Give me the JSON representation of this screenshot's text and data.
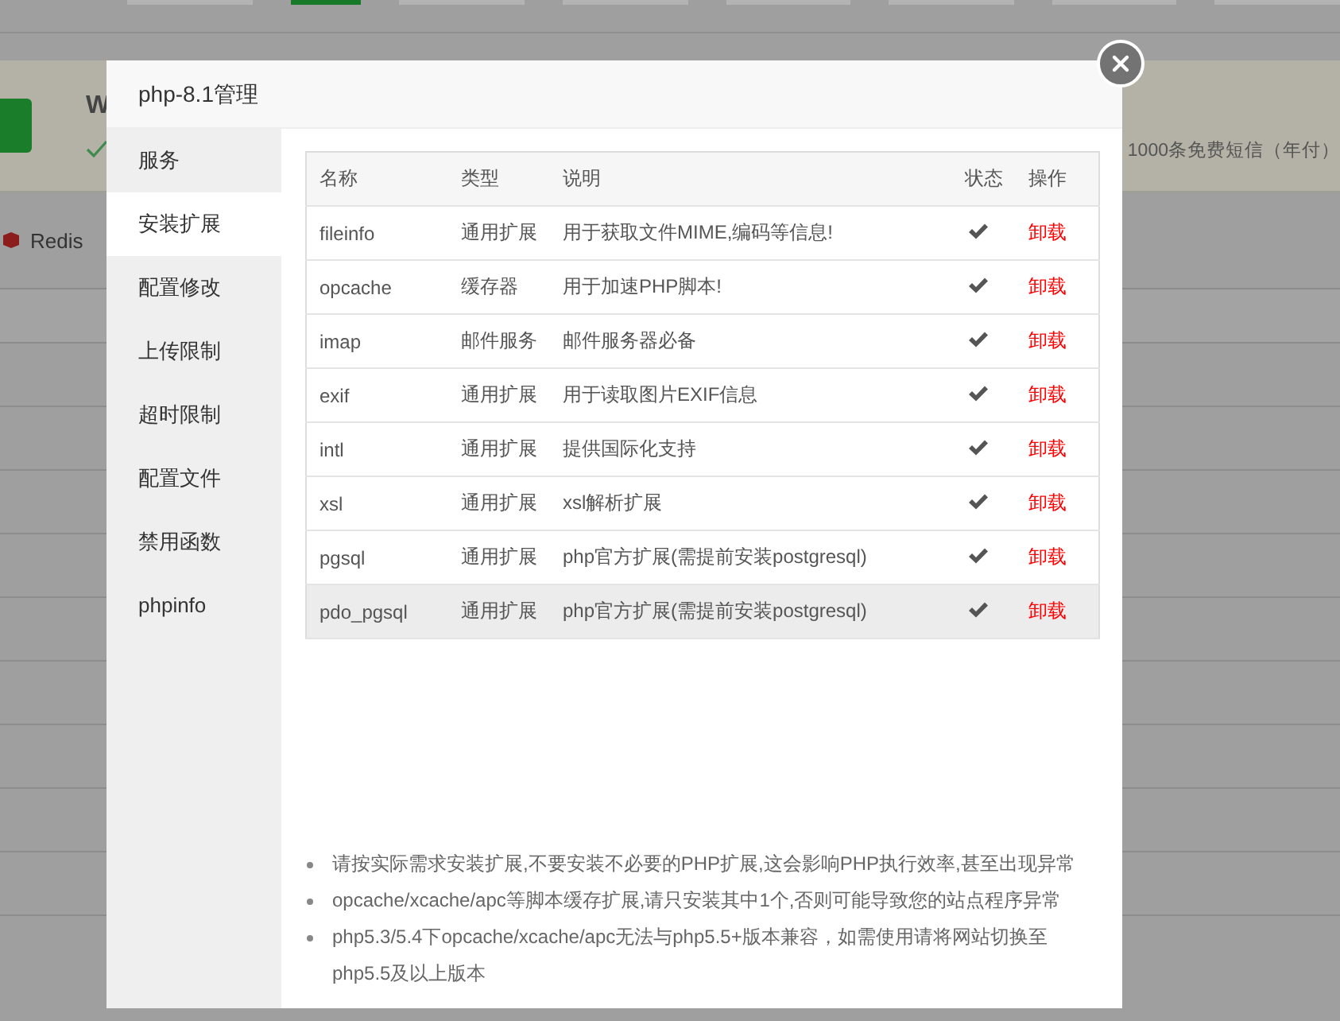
{
  "background": {
    "banner": {
      "title": "W",
      "note": "1000条免费短信（年付）"
    },
    "app_item": {
      "label": "Redis"
    }
  },
  "dialog": {
    "title": "php-8.1管理",
    "sidebar": [
      {
        "label": "服务",
        "selected": false
      },
      {
        "label": "安装扩展",
        "selected": true
      },
      {
        "label": "配置修改",
        "selected": false
      },
      {
        "label": "上传限制",
        "selected": false
      },
      {
        "label": "超时限制",
        "selected": false
      },
      {
        "label": "配置文件",
        "selected": false
      },
      {
        "label": "禁用函数",
        "selected": false
      },
      {
        "label": "phpinfo",
        "selected": false
      }
    ],
    "table": {
      "columns": [
        "名称",
        "类型",
        "说明",
        "状态",
        "操作"
      ],
      "rows": [
        {
          "name": "fileinfo",
          "type": "通用扩展",
          "description": "用于获取文件MIME,编码等信息!",
          "installed": true,
          "action": "卸载",
          "selected": false
        },
        {
          "name": "opcache",
          "type": "缓存器",
          "description": "用于加速PHP脚本!",
          "installed": true,
          "action": "卸载",
          "selected": false
        },
        {
          "name": "imap",
          "type": "邮件服务",
          "description": "邮件服务器必备",
          "installed": true,
          "action": "卸载",
          "selected": false
        },
        {
          "name": "exif",
          "type": "通用扩展",
          "description": "用于读取图片EXIF信息",
          "installed": true,
          "action": "卸载",
          "selected": false
        },
        {
          "name": "intl",
          "type": "通用扩展",
          "description": "提供国际化支持",
          "installed": true,
          "action": "卸载",
          "selected": false
        },
        {
          "name": "xsl",
          "type": "通用扩展",
          "description": "xsl解析扩展",
          "installed": true,
          "action": "卸载",
          "selected": false
        },
        {
          "name": "pgsql",
          "type": "通用扩展",
          "description": "php官方扩展(需提前安装postgresql)",
          "installed": true,
          "action": "卸载",
          "selected": false
        },
        {
          "name": "pdo_pgsql",
          "type": "通用扩展",
          "description": "php官方扩展(需提前安装postgresql)",
          "installed": true,
          "action": "卸载",
          "selected": true
        }
      ]
    },
    "notes": [
      "请按实际需求安装扩展,不要安装不必要的PHP扩展,这会影响PHP执行效率,甚至出现异常",
      "opcache/xcache/apc等脚本缓存扩展,请只安装其中1个,否则可能导致您的站点程序异常",
      "php5.3/5.4下opcache/xcache/apc无法与php5.5+版本兼容，如需使用请将网站切换至php5.5及以上版本"
    ]
  }
}
